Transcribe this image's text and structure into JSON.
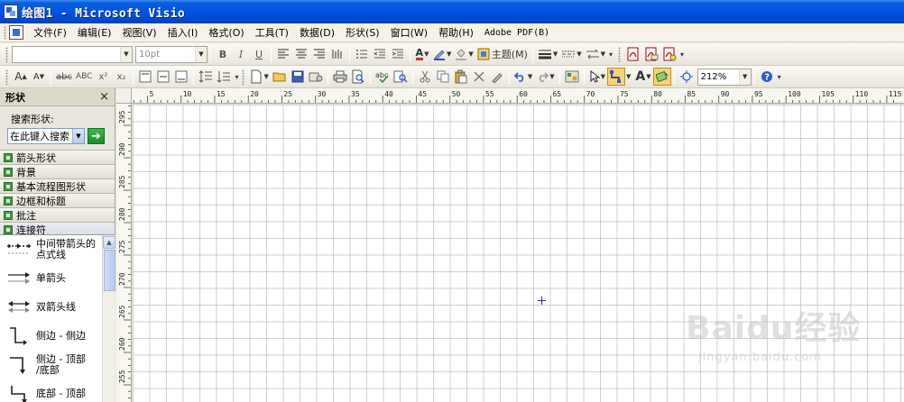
{
  "window": {
    "title": "绘图1 - Microsoft Visio"
  },
  "menubar": {
    "items": [
      "文件(F)",
      "编辑(E)",
      "视图(V)",
      "插入(I)",
      "格式(O)",
      "工具(T)",
      "数据(D)",
      "形状(S)",
      "窗口(W)",
      "帮助(H)",
      "Adobe PDF(B)"
    ]
  },
  "format_toolbar": {
    "font_name": "",
    "font_size_placeholder": "10pt",
    "bold": "B",
    "italic": "I",
    "underline": "U",
    "font_color_letter": "A",
    "theme_label": "主题(M)"
  },
  "standard_toolbar": {
    "increase_font": "A",
    "decrease_font": "A",
    "strike": "abc",
    "small_caps": "ABC",
    "superscript": "x²",
    "subscript": "x₂",
    "text_tool_letter": "A",
    "zoom_value": "212%"
  },
  "shapes_panel": {
    "title": "形状",
    "search_label": "搜索形状:",
    "search_placeholder": "在此键入搜索",
    "stencils": [
      "箭头形状",
      "背景",
      "基本流程图形状",
      "边框和标题",
      "批注",
      "连接符"
    ],
    "items": [
      {
        "label_line1": "中间带箭头的",
        "label_line2": "点式线",
        "icon": "dotted-arrow-line-icon"
      },
      {
        "label_line1": "单箭头",
        "label_line2": "",
        "icon": "single-arrow-icon"
      },
      {
        "label_line1": "双箭头线",
        "label_line2": "",
        "icon": "double-arrow-line-icon"
      },
      {
        "label_line1": "侧边 - 侧边",
        "label_line2": "",
        "icon": "side-to-side-connector-icon"
      },
      {
        "label_line1": "侧边 - 顶部",
        "label_line2": "/底部",
        "icon": "side-to-top-connector-icon"
      },
      {
        "label_line1": "底部 - 顶部",
        "label_line2": "",
        "icon": "bottom-to-top-connector-icon"
      }
    ]
  },
  "rulers": {
    "horizontal_labels": [
      "5",
      "10",
      "15",
      "20",
      "25",
      "30",
      "35",
      "40",
      "45",
      "50",
      "55",
      "60",
      "65",
      "70",
      "75",
      "80",
      "85",
      "90",
      "95",
      "100",
      "105",
      "110",
      "115"
    ],
    "vertical_labels": [
      "295",
      "290",
      "285",
      "280",
      "275",
      "270",
      "265",
      "260",
      "255"
    ]
  },
  "watermark": {
    "brand": "Baidu经验",
    "url": "jingyan.baidu.com"
  }
}
